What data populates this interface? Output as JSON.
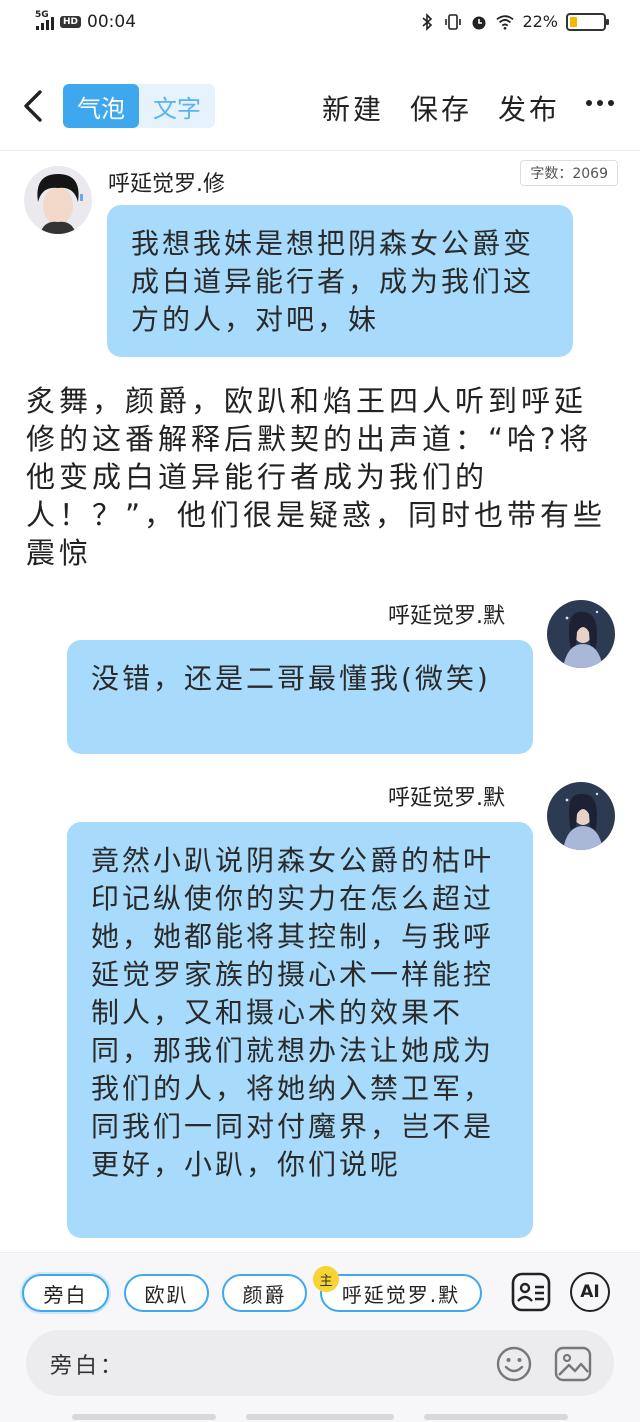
{
  "status_bar": {
    "network": "5G",
    "hd_badge": "HD",
    "time": "00:04",
    "battery_percent": "22%",
    "battery_level": 0.22,
    "icons": [
      "bluetooth-icon",
      "vibrate-icon",
      "alarm-icon",
      "wifi-icon",
      "battery-icon"
    ]
  },
  "toolbar": {
    "back_icon": "chevron-left-icon",
    "mode_tabs": [
      {
        "label": "气泡",
        "active": true
      },
      {
        "label": "文字",
        "active": false
      }
    ],
    "new_label": "新建",
    "save_label": "保存",
    "publish_label": "发布",
    "more_icon": "more-horizontal-icon"
  },
  "word_count": "字数：2069",
  "messages": [
    {
      "speaker": "呼延觉罗.修",
      "side": "left",
      "text": "我想我妹是想把阴森女公爵变成白道异能行者，成为我们这方的人，对吧，妹"
    },
    {
      "speaker": "呼延觉罗.默",
      "side": "right",
      "text": "没错，还是二哥最懂我(微笑)"
    },
    {
      "speaker": "呼延觉罗.默",
      "side": "right",
      "text": "竟然小趴说阴森女公爵的枯叶印记纵使你的实力在怎么超过她，她都能将其控制，与我呼延觉罗家族的摄心术一样能控制人，又和摄心术的效果不同，那我们就想办法让她成为我们的人，将她纳入禁卫军，同我们一同对付魔界，岂不是更好，小趴，你们说呢"
    }
  ],
  "narration": "炙舞，颜爵，欧趴和焰王四人听到呼延修的这番解释后默契的出声道：“哈?将他变成白道异能行者成为我们的人！？”，他们很是疑惑，同时也带有些震惊",
  "role_chips": [
    {
      "label": "旁白",
      "active": true
    },
    {
      "label": "欧趴",
      "active": false
    },
    {
      "label": "颜爵",
      "active": false
    },
    {
      "label": "呼延觉罗.默",
      "active": false,
      "badge": "主"
    }
  ],
  "tools": {
    "contact_card_icon": "contact-card-icon",
    "ai_label": "AI"
  },
  "input": {
    "label": "旁白：",
    "emoji_icon": "emoji-icon",
    "image_icon": "image-icon"
  },
  "colors": {
    "accent": "#3fa7ee",
    "bubble": "#a8dbfb",
    "badge": "#f7d334"
  }
}
